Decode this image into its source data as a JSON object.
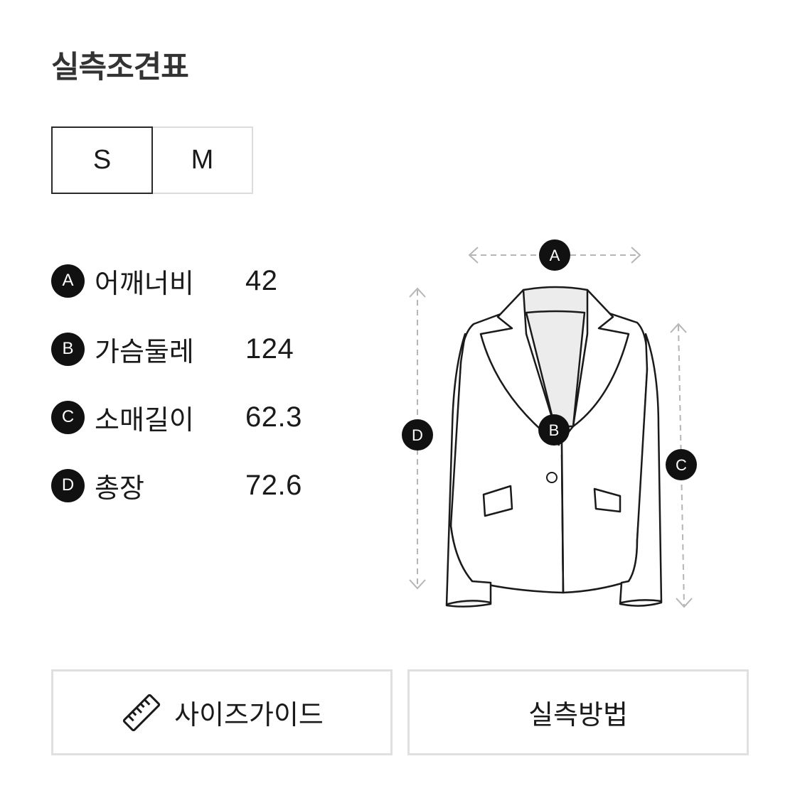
{
  "title": "실측조견표",
  "sizes": [
    {
      "label": "S",
      "selected": true
    },
    {
      "label": "M",
      "selected": false
    }
  ],
  "measurements": [
    {
      "marker": "A",
      "label": "어깨너비",
      "value": "42"
    },
    {
      "marker": "B",
      "label": "가슴둘레",
      "value": "124"
    },
    {
      "marker": "C",
      "label": "소매길이",
      "value": "62.3"
    },
    {
      "marker": "D",
      "label": "총장",
      "value": "72.6"
    }
  ],
  "diagram": {
    "markers": [
      "A",
      "B",
      "C",
      "D"
    ]
  },
  "buttons": {
    "size_guide": {
      "label": "사이즈가이드",
      "icon": "ruler-icon"
    },
    "measure_method": {
      "label": "실측방법"
    }
  }
}
